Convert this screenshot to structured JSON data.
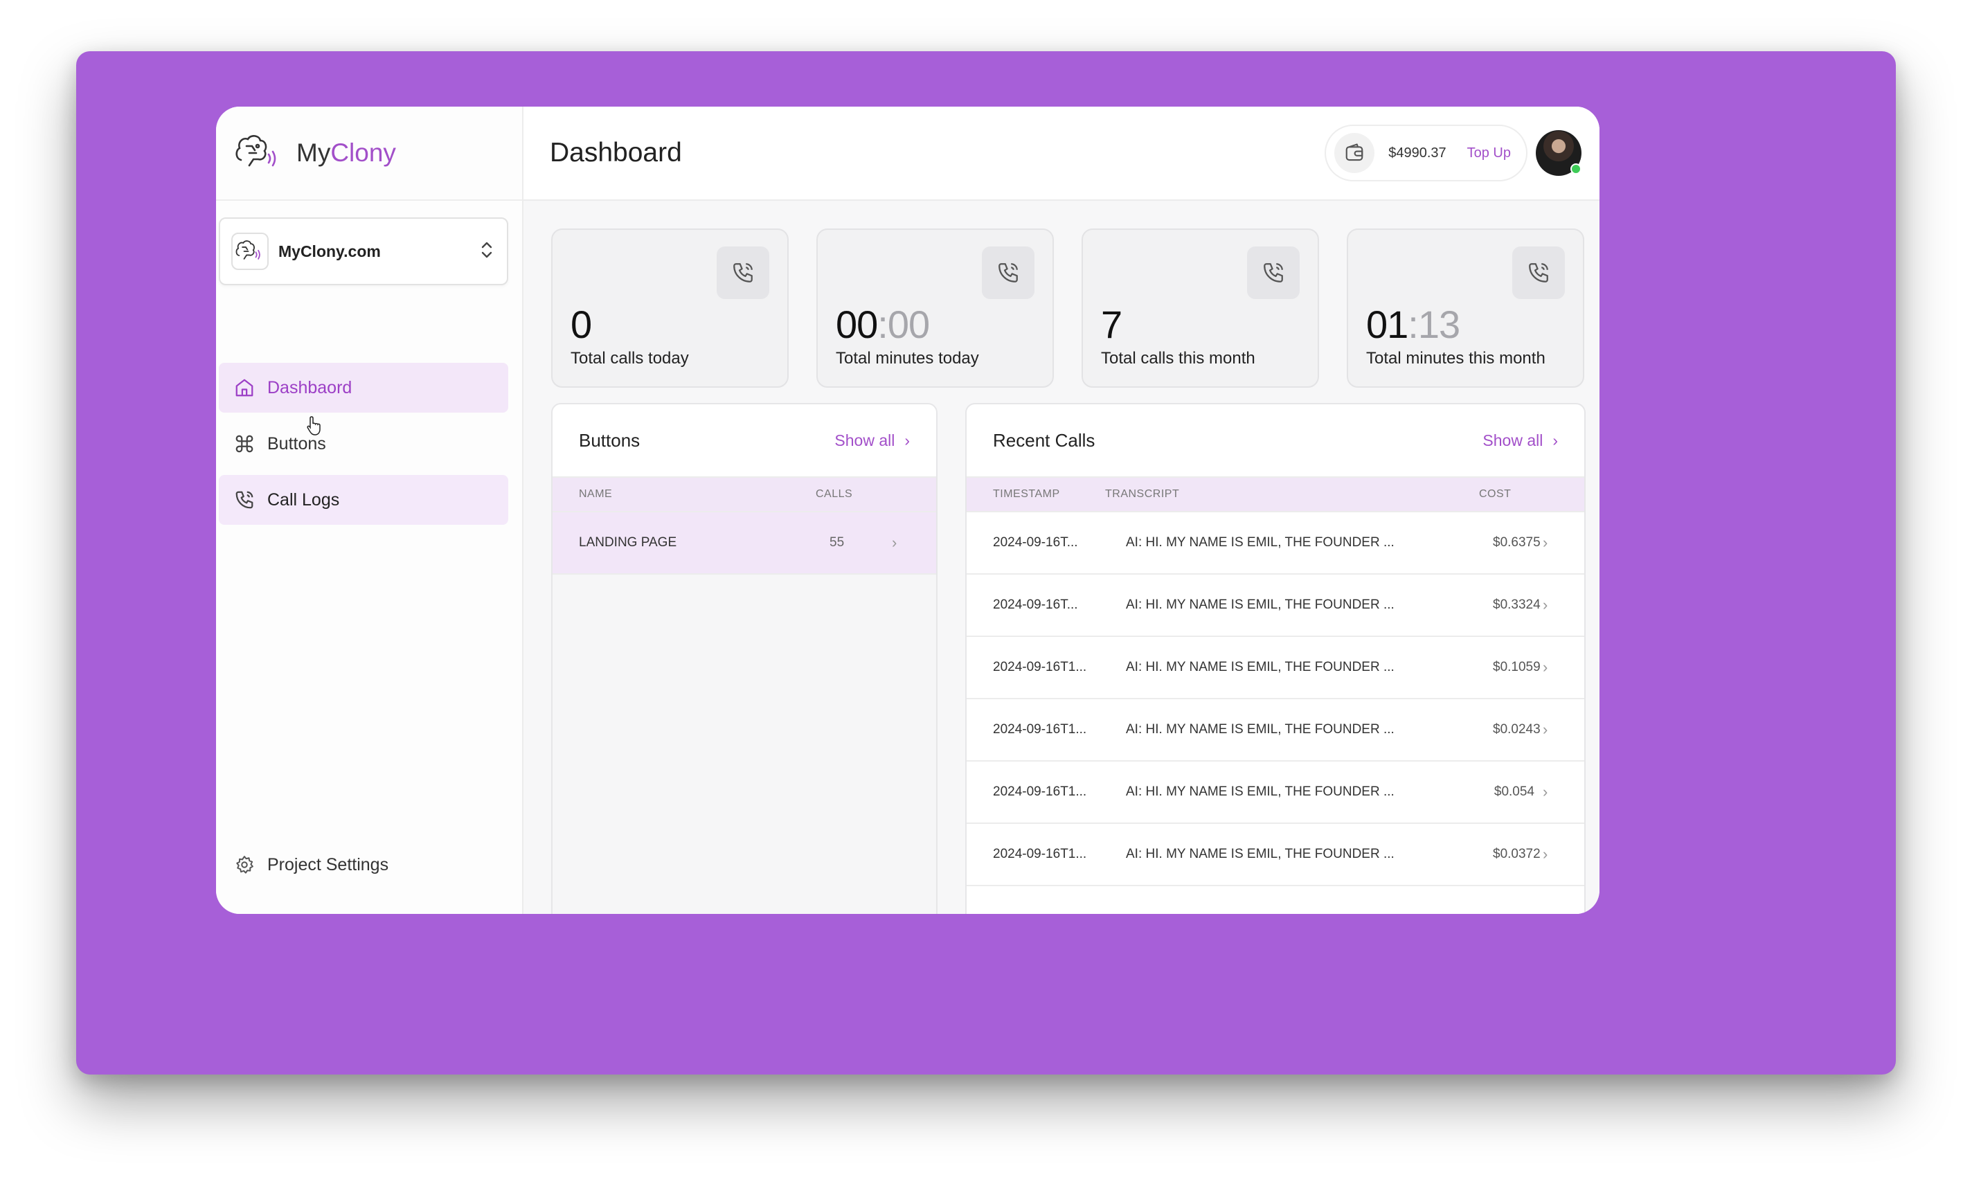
{
  "brand": {
    "name_plain": "My",
    "name_accent": "Clony"
  },
  "project": {
    "name": "MyClony.com"
  },
  "nav": {
    "items": [
      {
        "label": "Dashbaord"
      },
      {
        "label": "Buttons"
      },
      {
        "label": "Call Logs"
      }
    ],
    "settings_label": "Project Settings"
  },
  "header": {
    "title": "Dashboard",
    "balance": "$4990.37",
    "topup_label": "Top Up"
  },
  "stats": [
    {
      "value_main": "0",
      "value_dim": "",
      "label": "Total calls today"
    },
    {
      "value_main": "00",
      "value_dim": ":00",
      "label": "Total minutes today"
    },
    {
      "value_main": "7",
      "value_dim": "",
      "label": "Total calls this month"
    },
    {
      "value_main": "01",
      "value_dim": ":13",
      "label": "Total minutes this month"
    }
  ],
  "buttons_panel": {
    "title": "Buttons",
    "show_all": "Show all",
    "columns": {
      "name": "NAME",
      "calls": "CALLS"
    },
    "rows": [
      {
        "name": "LANDING PAGE",
        "calls": "55"
      }
    ]
  },
  "calls_panel": {
    "title": "Recent Calls",
    "show_all": "Show all",
    "columns": {
      "timestamp": "TIMESTAMP",
      "transcript": "TRANSCRIPT",
      "cost": "COST"
    },
    "rows": [
      {
        "timestamp": "2024-09-16T...",
        "transcript": "AI: HI. MY NAME IS EMIL, THE FOUNDER ...",
        "cost": "$0.6375"
      },
      {
        "timestamp": "2024-09-16T...",
        "transcript": "AI: HI. MY NAME IS EMIL, THE FOUNDER ...",
        "cost": "$0.3324"
      },
      {
        "timestamp": "2024-09-16T1...",
        "transcript": "AI: HI. MY NAME IS EMIL, THE FOUNDER ...",
        "cost": "$0.1059"
      },
      {
        "timestamp": "2024-09-16T1...",
        "transcript": "AI: HI. MY NAME IS EMIL, THE FOUNDER ...",
        "cost": "$0.0243"
      },
      {
        "timestamp": "2024-09-16T1...",
        "transcript": "AI: HI. MY NAME IS EMIL, THE FOUNDER ...",
        "cost": "$0.054"
      },
      {
        "timestamp": "2024-09-16T1...",
        "transcript": "AI: HI. MY NAME IS EMIL, THE FOUNDER ...",
        "cost": "$0.0372"
      }
    ]
  },
  "colors": {
    "background": "#a75fd8",
    "accent": "#a24fc9",
    "active_nav_bg": "#f3e7f9"
  }
}
